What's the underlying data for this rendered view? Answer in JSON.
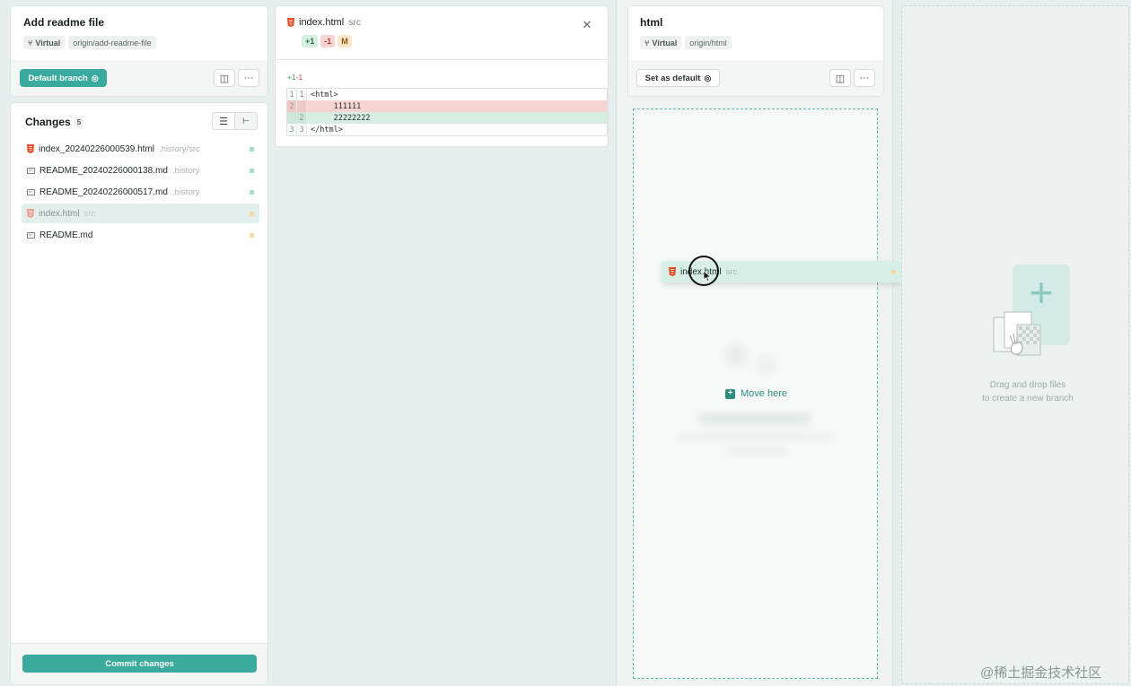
{
  "left_panel": {
    "title": "Add readme file",
    "tag_virtual": "Virtual",
    "tag_origin": "origin/add-readme-file",
    "default_branch_label": "Default branch",
    "changes_label": "Changes",
    "changes_count": "5",
    "files": [
      {
        "name": "index_20240226000539.html",
        "dir": ".history/src",
        "type": "html",
        "status_color": "#a7dccd"
      },
      {
        "name": "README_20240226000138.md",
        "dir": ".history",
        "type": "md",
        "status_color": "#a7dccd"
      },
      {
        "name": "README_20240226000517.md",
        "dir": ".history",
        "type": "md",
        "status_color": "#a7dccd"
      },
      {
        "name": "index.html",
        "dir": "src",
        "type": "html",
        "status_color": "#f5d9a6"
      },
      {
        "name": "README.md",
        "dir": "",
        "type": "md",
        "status_color": "#f5d9a6"
      }
    ],
    "commit_label": "Commit changes"
  },
  "diff_panel": {
    "file_name": "index.html",
    "file_dir": "src",
    "badge_add": "+1",
    "badge_del": "-1",
    "badge_mod": "M",
    "summary_add": "+1",
    "summary_del": "-1",
    "lines": [
      {
        "old": "1",
        "new": "1",
        "text": "<html>",
        "kind": "ctx"
      },
      {
        "old": "2",
        "new": "",
        "text": "     111111",
        "kind": "del"
      },
      {
        "old": "",
        "new": "2",
        "text": "     22222222",
        "kind": "add"
      },
      {
        "old": "3",
        "new": "3",
        "text": "</html>",
        "kind": "ctx"
      }
    ]
  },
  "html_panel": {
    "title": "html",
    "tag_virtual": "Virtual",
    "tag_origin": "origin/html",
    "set_default_label": "Set as default"
  },
  "drag_item": {
    "name": "index.html",
    "dir": "src"
  },
  "drop_zone": {
    "move_here": "Move here"
  },
  "new_branch_zone": {
    "line1": "Drag and drop files",
    "line2": "to create a new branch"
  },
  "watermark": "@稀土掘金技术社区",
  "colors": {
    "accent": "#3aa99e",
    "add_bg": "#d7eee3",
    "del_bg": "#f6d4d2",
    "html_icon": "#e34c26"
  }
}
